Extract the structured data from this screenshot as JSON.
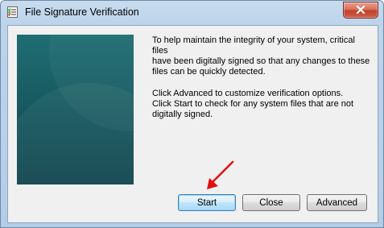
{
  "window": {
    "title": "File Signature Verification"
  },
  "body": {
    "paragraph1": "To help maintain the integrity of your system, critical files\nhave been digitally signed so that any changes to these\nfiles can be quickly detected.",
    "paragraph2": "Click Advanced to customize verification options.\nClick Start to check for any system files that are not\ndigitally signed."
  },
  "buttons": {
    "start": "Start",
    "close": "Close",
    "advanced": "Advanced"
  },
  "icons": {
    "app": "checklist-icon",
    "close": "close-icon",
    "annotation": "red-arrow-icon"
  },
  "colors": {
    "accent": "#3c7fb1",
    "panel": "#16565e",
    "close_button": "#c0412b",
    "annotation_arrow": "#e01010"
  }
}
